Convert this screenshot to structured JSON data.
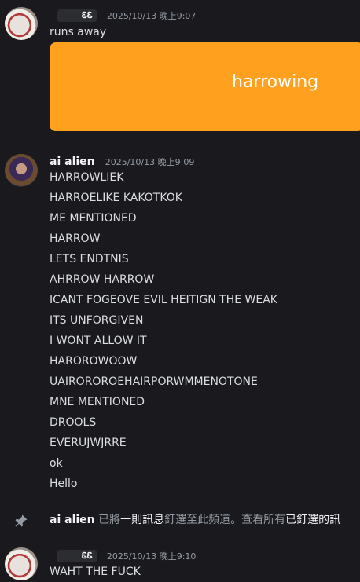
{
  "messages": [
    {
      "author": "",
      "tag": "   ᏋᏋ",
      "timestamp": "2025/10/13 晚上9:07",
      "lines": [
        "runs away"
      ],
      "embed": {
        "text": "harrowing",
        "color": "#ffa11e"
      }
    },
    {
      "author": "ai alien",
      "timestamp": "2025/10/13 晚上9:09",
      "lines": [
        "HARROWLIEK",
        "HARROELIKE KAKOTKOK",
        "ME MENTIONED",
        "HARROW",
        "LETS ENDTNIS",
        "AHRROW HARROW",
        "ICANT FOGEOVE EVIL HEITIGN THE WEAK",
        "ITS UNFORGIVEN",
        "I WONT ALLOW IT",
        "HAROROWOOW",
        "UAIROROROEHAIRPORWMMENOTONE",
        "MNE MENTIONED",
        "DROOLS",
        "EVERUJWJRRE",
        "ok",
        "Hello"
      ]
    },
    {
      "author": "",
      "tag": "   ᏋᏋ",
      "timestamp": "2025/10/13 晚上9:10",
      "lines": [
        "WAHT THE FUCK"
      ]
    }
  ],
  "system": {
    "actor": "ai alien",
    "text_pre": "已將",
    "link1": "一則訊息",
    "text_mid": "釘選至此頻道。查看所有",
    "link2": "已釘選的訊"
  },
  "icons": {
    "pin": "pin-icon"
  }
}
